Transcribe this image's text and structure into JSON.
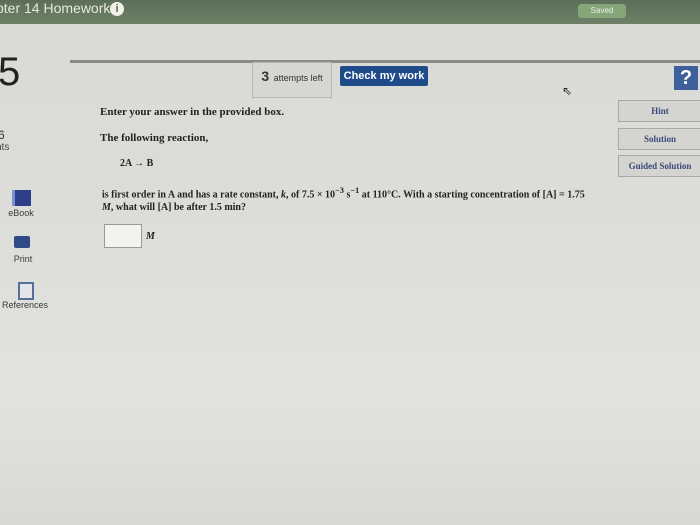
{
  "header": {
    "title": "pter 14 Homework",
    "info_glyph": "i",
    "saved_label": "Saved"
  },
  "question": {
    "number": "5",
    "points_value": "6",
    "points_label": "nts",
    "attempts_count": "3",
    "attempts_label": "attempts left",
    "check_label": "Check my work",
    "help_glyph": "?",
    "instruction": "Enter your answer in the provided box.",
    "intro": "The following reaction,",
    "reaction": "2A → B",
    "body_part1": "is first order in A and has a rate constant, ",
    "k_symbol": "k",
    "body_part2": ", of 7.5 × 10",
    "exp1": "−3",
    "body_part3": " s",
    "exp2": "−1",
    "body_part4": " at 110°C. With a starting concentration of [A] = 1.75 ",
    "molar_symbol": "M",
    "body_part5": ", what will [A] be after 1.5 min?",
    "answer_value": "",
    "unit": "M"
  },
  "sidebar": {
    "ebook_label": "eBook",
    "print_label": "Print",
    "references_label": "References"
  },
  "actions": {
    "hint_label": "Hint",
    "solution_label": "Solution",
    "guided_label": "Guided Solution"
  }
}
